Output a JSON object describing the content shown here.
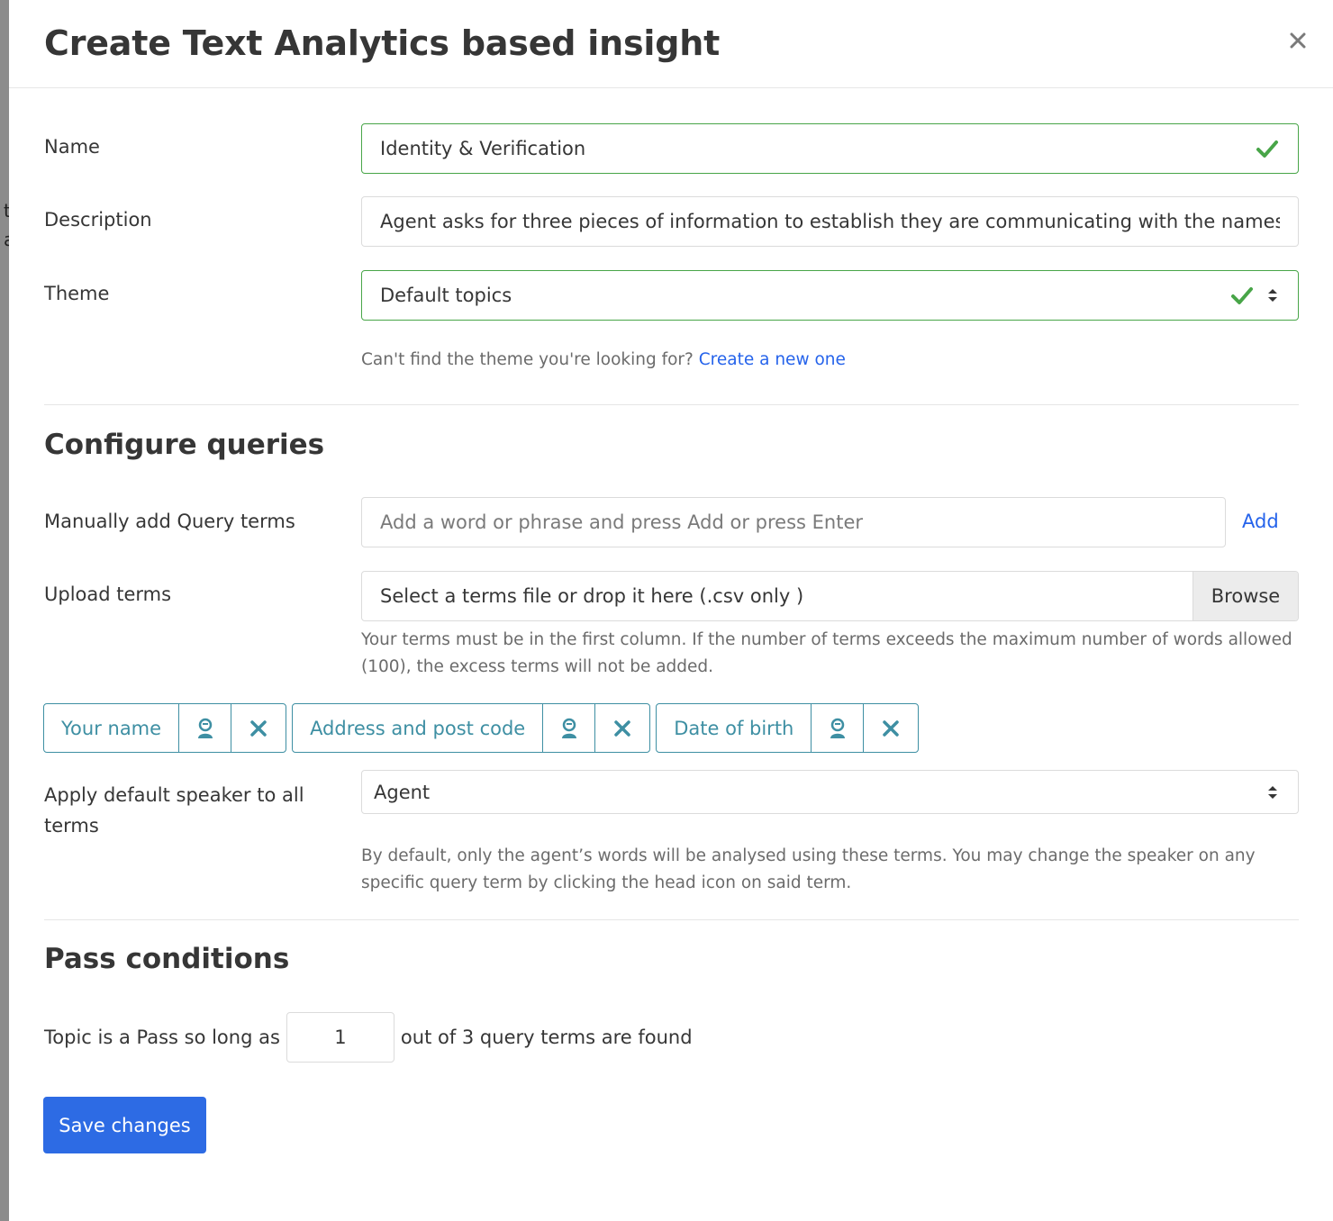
{
  "modal": {
    "title": "Create Text Analytics based insight"
  },
  "form": {
    "name_label": "Name",
    "name_value": "Identity & Verification",
    "description_label": "Description",
    "description_value": "Agent asks for three pieces of information to establish they are communicating with the names",
    "theme_label": "Theme",
    "theme_value": "Default topics",
    "theme_help_text": "Can't find the theme you're looking for?",
    "theme_help_link": "Create a new one"
  },
  "queries": {
    "section_title": "Configure queries",
    "manual_label": "Manually add Query terms",
    "manual_placeholder": "Add a word or phrase and press Add or press Enter",
    "add_label": "Add",
    "upload_label": "Upload terms",
    "upload_value": "Select a terms file or drop it here (.csv only )",
    "browse_label": "Browse",
    "upload_help": "Your terms must be in the first column. If the number of terms exceeds the maximum number of words allowed (100), the excess terms will not be added.",
    "terms": [
      {
        "label": "Your name",
        "speaker_icon": "person-icon",
        "remove_icon": "close-icon"
      },
      {
        "label": "Address and post code",
        "speaker_icon": "person-icon",
        "remove_icon": "close-icon"
      },
      {
        "label": "Date of birth",
        "speaker_icon": "person-icon",
        "remove_icon": "close-icon"
      }
    ],
    "speaker_label": "Apply default speaker to all terms",
    "speaker_value": "Agent",
    "speaker_help": "By default, only the agent’s words will be analysed using these terms. You may change the speaker on any specific query term by clicking the head icon on said term."
  },
  "pass": {
    "section_title": "Pass conditions",
    "prefix": "Topic is a Pass so long as",
    "value": "1",
    "suffix": "out of 3 query terms are found"
  },
  "actions": {
    "save_label": "Save changes"
  },
  "colors": {
    "valid": "#48a548",
    "tag": "#3e8fa3",
    "primary": "#2d6be4",
    "link": "#2563eb"
  }
}
